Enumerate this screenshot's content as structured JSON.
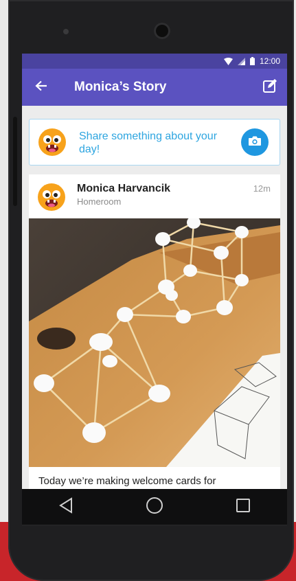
{
  "status_bar": {
    "time": "12:00",
    "icons": [
      "wifi-icon",
      "signal-icon",
      "battery-icon"
    ]
  },
  "toolbar": {
    "title": "Monica’s Story",
    "back_icon": "arrow-left-icon",
    "edit_icon": "edit-icon"
  },
  "share_prompt": {
    "text": "Share something about your day!",
    "camera_icon": "camera-icon"
  },
  "post": {
    "author": "Monica Harvancik",
    "class_name": "Homeroom",
    "time": "12m",
    "caption": "Today we’re making welcome cards for"
  },
  "nav_bar": {
    "icons": [
      "back-triangle-icon",
      "home-circle-icon",
      "recents-square-icon"
    ]
  },
  "colors": {
    "status_bar": "#4a43a0",
    "toolbar": "#5b52c0",
    "accent_blue": "#2da5e0",
    "camera_button": "#1f97e0"
  }
}
